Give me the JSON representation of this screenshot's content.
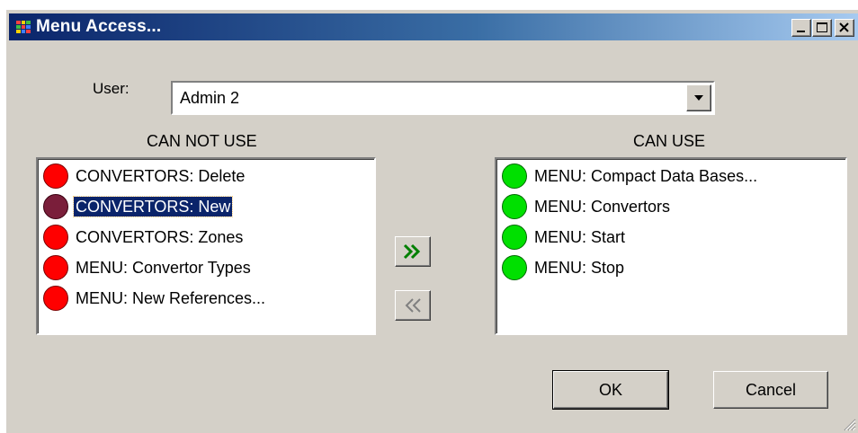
{
  "window": {
    "title": "Menu Access...",
    "colors": {
      "titlebar_start": "#0a246a",
      "titlebar_end": "#a6caf0",
      "face": "#d4d0c8"
    }
  },
  "user": {
    "label": "User:",
    "value": "Admin 2"
  },
  "can_not_use": {
    "header": "CAN NOT USE",
    "items": [
      {
        "label": "CONVERTORS: Delete",
        "icon": "red-dot-icon",
        "selected": false
      },
      {
        "label": "CONVERTORS: New",
        "icon": "red-dot-icon",
        "selected": true
      },
      {
        "label": "CONVERTORS: Zones",
        "icon": "red-dot-icon",
        "selected": false
      },
      {
        "label": "MENU: Convertor Types",
        "icon": "red-dot-icon",
        "selected": false
      },
      {
        "label": "MENU: New References...",
        "icon": "red-dot-icon",
        "selected": false
      }
    ]
  },
  "can_use": {
    "header": "CAN USE",
    "items": [
      {
        "label": "MENU: Compact Data Bases...",
        "icon": "green-dot-icon"
      },
      {
        "label": "MENU: Convertors",
        "icon": "green-dot-icon"
      },
      {
        "label": "MENU: Start",
        "icon": "green-dot-icon"
      },
      {
        "label": "MENU: Stop",
        "icon": "green-dot-icon"
      }
    ]
  },
  "buttons": {
    "ok": "OK",
    "cancel": "Cancel"
  }
}
